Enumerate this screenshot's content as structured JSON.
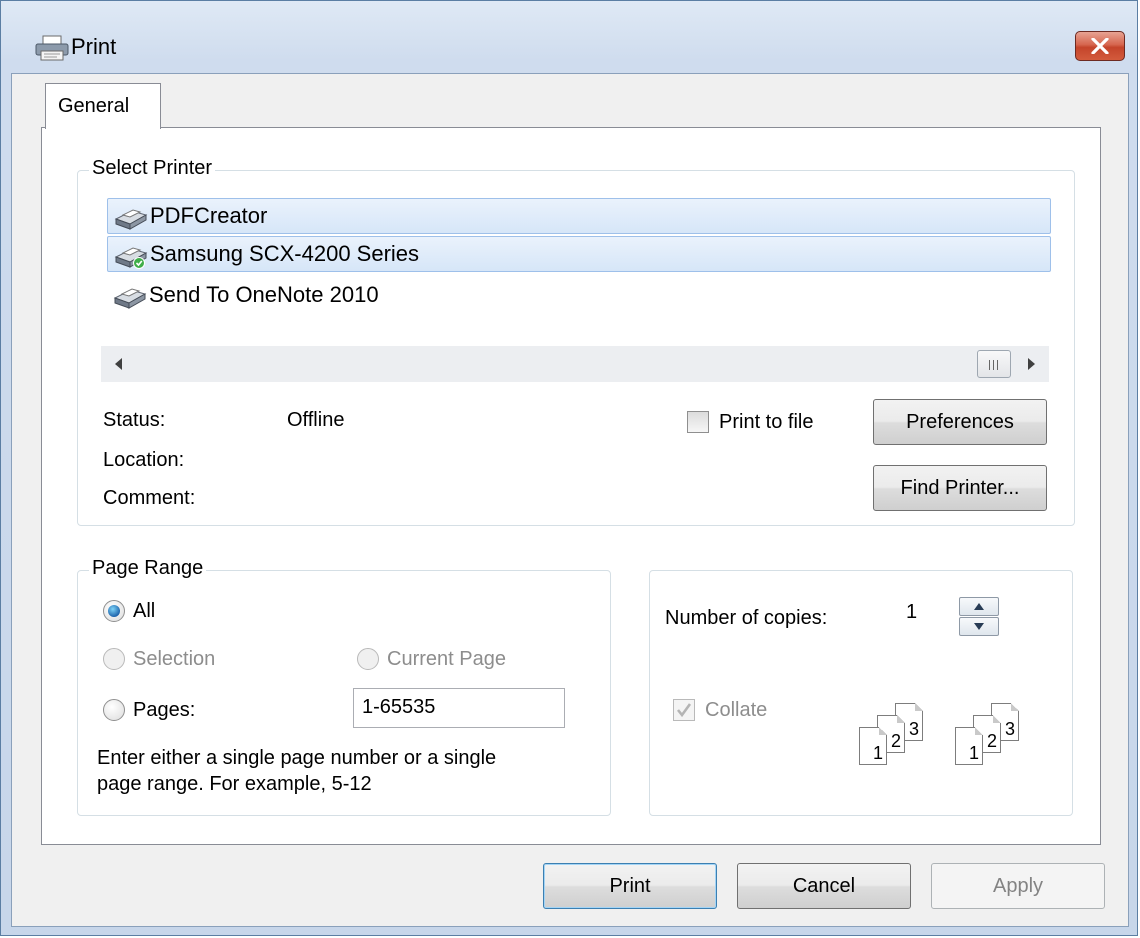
{
  "window": {
    "title": "Print",
    "close_label": "✕"
  },
  "tabs": [
    {
      "label": "General"
    }
  ],
  "select_printer": {
    "legend": "Select Printer",
    "printers": [
      {
        "name": "PDFCreator",
        "selected": false
      },
      {
        "name": "Samsung SCX-4200 Series",
        "selected": true
      },
      {
        "name": "Send To OneNote 2010",
        "selected": false
      }
    ],
    "status_label": "Status:",
    "status_value": "Offline",
    "location_label": "Location:",
    "location_value": "",
    "comment_label": "Comment:",
    "comment_value": "",
    "print_to_file_label": "Print to file",
    "print_to_file_checked": false,
    "preferences_label": "Preferences",
    "find_printer_label": "Find Printer..."
  },
  "page_range": {
    "legend": "Page Range",
    "all_label": "All",
    "selection_label": "Selection",
    "current_page_label": "Current Page",
    "pages_label": "Pages:",
    "pages_value": "1-65535",
    "hint_line1": "Enter either a single page number or a single",
    "hint_line2": "page range.  For example, 5-12",
    "selected": "All"
  },
  "copies": {
    "label": "Number of copies:",
    "value": "1",
    "collate_label": "Collate",
    "collate_checked": true,
    "collate_pages": [
      "1",
      "2",
      "3"
    ]
  },
  "buttons": {
    "print": "Print",
    "cancel": "Cancel",
    "apply": "Apply"
  },
  "icons": {
    "title": "printer-icon",
    "printer_row": "printer-icon",
    "default_printer_badge": "check-badge-icon"
  },
  "colors": {
    "selection_fill": "#d6e6f8",
    "selection_border": "#9ec0ea",
    "close_button": "#c4442b",
    "radio_checked": "#1a5fa8",
    "disabled_text": "#8d8d8d"
  }
}
